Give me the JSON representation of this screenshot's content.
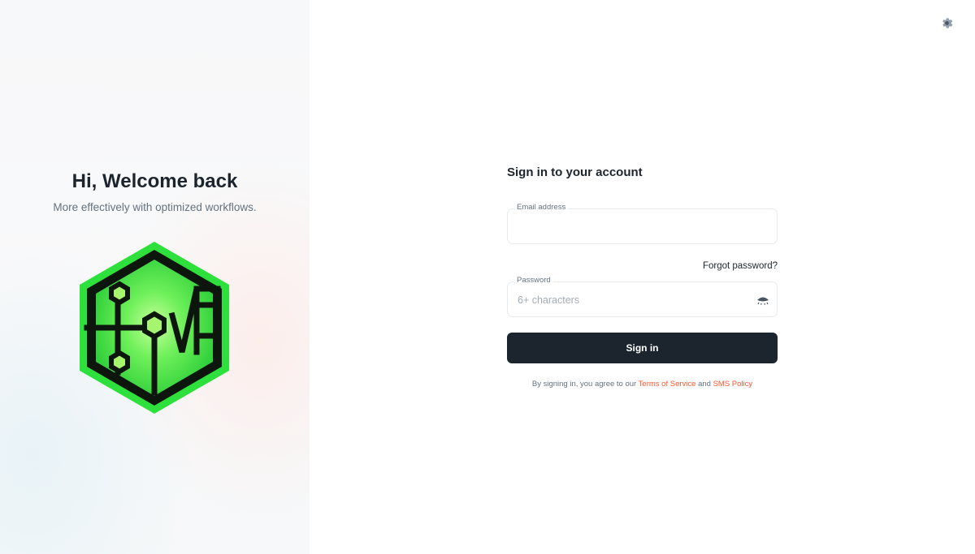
{
  "left": {
    "title": "Hi, Welcome back",
    "subtitle": "More effectively with optimized workflows."
  },
  "header": {
    "settings_icon": "gear-icon"
  },
  "form": {
    "title": "Sign in to your account",
    "email": {
      "label": "Email address",
      "value": "",
      "placeholder": ""
    },
    "forgot_password": "Forgot password?",
    "password": {
      "label": "Password",
      "value": "",
      "placeholder": "6+ characters",
      "toggle_icon": "eye-icon"
    },
    "submit_label": "Sign in",
    "terms": {
      "prefix": "By signing in, you agree to our",
      "terms_link": "Terms of Service",
      "conjunction": "and",
      "policy_link": "SMS Policy"
    }
  },
  "colors": {
    "primary_dark": "#1c252e",
    "link_accent": "#ff5630",
    "logo_green": "#3ddc4a",
    "logo_dark": "#0d160d"
  }
}
